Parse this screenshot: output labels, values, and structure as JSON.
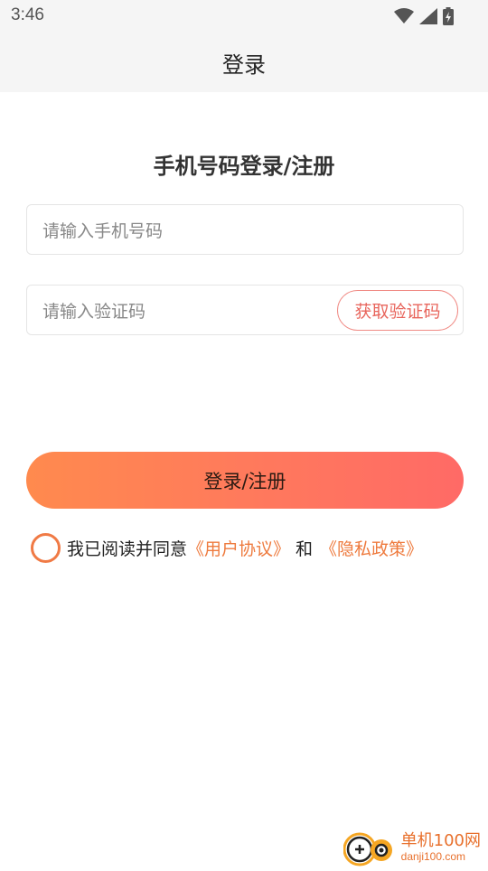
{
  "status_bar": {
    "time": "3:46",
    "icons": [
      "wifi-icon",
      "signal-icon",
      "battery-charging-icon"
    ]
  },
  "nav": {
    "title": "登录"
  },
  "form": {
    "heading": "手机号码登录/注册",
    "phone_placeholder": "请输入手机号码",
    "code_placeholder": "请输入验证码",
    "get_code_label": "获取验证码",
    "submit_label": "登录/注册"
  },
  "agreement": {
    "checked": false,
    "prefix": "我已阅读并同意",
    "user_agreement": "《用户协议》",
    "conjunction": "和",
    "privacy_policy": "《隐私政策》"
  },
  "watermark": {
    "name": "单机100网",
    "url": "danji100.com"
  },
  "colors": {
    "accent": "#ee7a3d",
    "gradient_start": "#ff8a4e",
    "gradient_end": "#ff6a66",
    "code_button": "#e8655c",
    "bar_background": "#f5f5f5"
  }
}
